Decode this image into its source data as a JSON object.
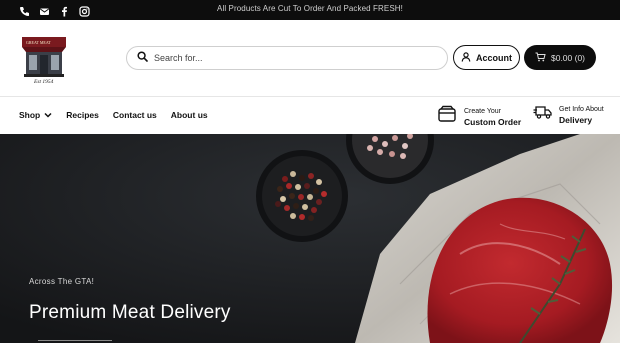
{
  "topbar": {
    "icons": [
      "phone-icon",
      "mail-icon",
      "facebook-icon",
      "instagram-icon"
    ],
    "announcement": "All Products Are Cut To Order And Packed FRESH!"
  },
  "header": {
    "logo_alt": "Est 1954",
    "search": {
      "placeholder": "Search for..."
    },
    "account_label": "Account",
    "cart_label": "$0.00 (0)"
  },
  "nav": {
    "items": [
      {
        "label": "Shop",
        "has_dropdown": true
      },
      {
        "label": "Recipes"
      },
      {
        "label": "Contact us"
      },
      {
        "label": "About us"
      }
    ],
    "features": [
      {
        "line1": "Create Your",
        "line2": "Custom Order",
        "icon": "box-icon"
      },
      {
        "line1": "Get Info About",
        "line2": "Delivery",
        "icon": "truck-icon"
      }
    ]
  },
  "hero": {
    "subtitle": "Across The GTA!",
    "title": "Premium Meat Delivery"
  },
  "colors": {
    "topbar_bg": "#0d0d0d",
    "cart_bg": "#0d0d0d",
    "hero_bg": "#1b1d1f"
  }
}
